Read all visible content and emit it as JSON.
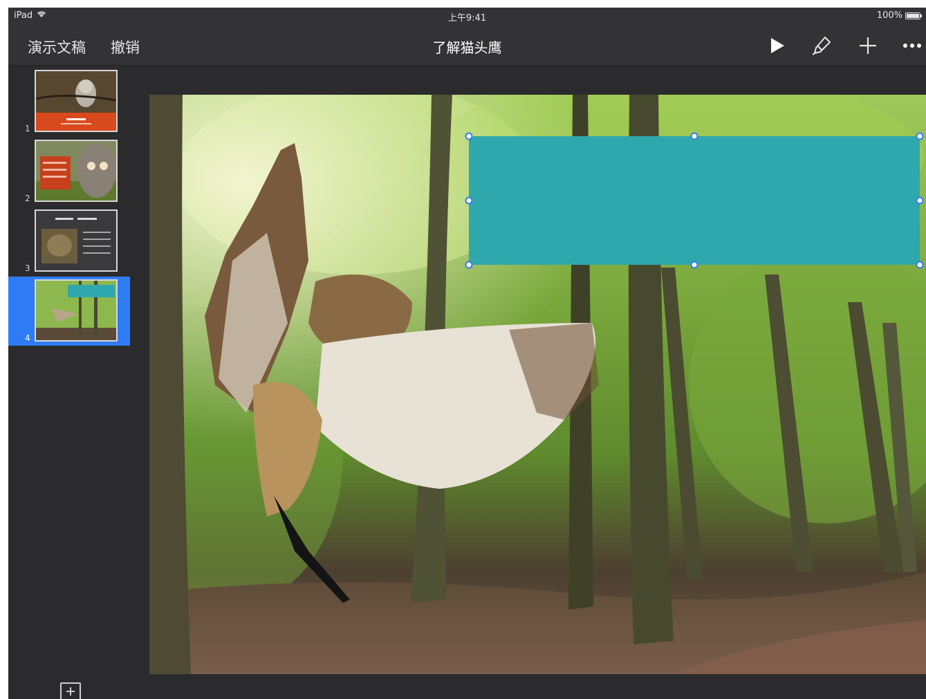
{
  "status_bar": {
    "device": "iPad",
    "time": "上午9:41",
    "battery": "100%",
    "battery_level": 1.0
  },
  "toolbar": {
    "presentations_label": "演示文稿",
    "undo_label": "撤销",
    "title": "了解猫头鹰",
    "icons": [
      "play-icon",
      "brush-icon",
      "plus-icon",
      "more-icon"
    ]
  },
  "sidebar": {
    "slides": [
      {
        "number": "1",
        "thumb_title": "了解猫头鹰",
        "selected": false
      },
      {
        "number": "2",
        "selected": false
      },
      {
        "number": "3",
        "selected": false
      },
      {
        "number": "4",
        "selected": true
      }
    ],
    "add_icon": "add-slide-icon"
  },
  "colors": {
    "accent": "#2f7bf5",
    "shape_fill": "#2fa8ad",
    "toolbar_bg": "#333336",
    "canvas_bg": "#2b2b2d"
  }
}
